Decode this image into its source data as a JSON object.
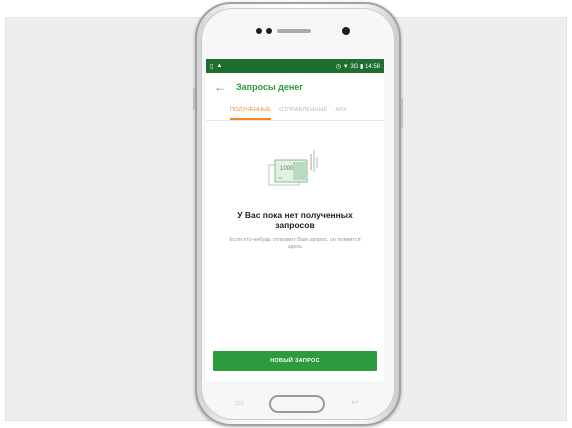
{
  "statusbar": {
    "time": "14:58",
    "signal": "3G",
    "battery_icon": "battery-icon",
    "wifi_icon": "wifi-icon"
  },
  "toolbar": {
    "back_icon": "←",
    "title": "Запросы денег"
  },
  "tabs": [
    {
      "label": "ПОЛУЧЕННЫЕ",
      "active": true
    },
    {
      "label": "ОТПРАВЛЕННЫЕ",
      "active": false
    },
    {
      "label": "АРХ",
      "active": false
    }
  ],
  "empty_state": {
    "illustration_amount": "1000",
    "title": "У Вас пока нет полученных запросов",
    "description": "Если кто-нибудь отправит Вам запрос, он появится здесь"
  },
  "new_request_button": "НОВЫЙ ЗАПРОС",
  "colors": {
    "accent_green": "#2d9b3d",
    "status_green": "#1f6e2f",
    "tab_orange": "#f28a1b"
  }
}
